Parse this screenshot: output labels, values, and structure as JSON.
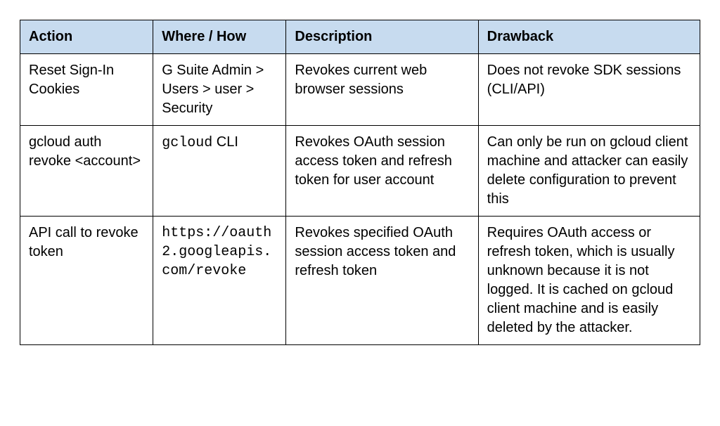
{
  "chart_data": {
    "type": "table",
    "headers": [
      "Action",
      "Where / How",
      "Description",
      "Drawback"
    ],
    "rows": [
      {
        "action": "Reset Sign-In Cookies",
        "where_plain": "G Suite Admin > Users > user > Security",
        "where_segments": null,
        "description": "Revokes current web browser sessions",
        "drawback": "Does not revoke SDK sessions (CLI/API)"
      },
      {
        "action": "gcloud auth revoke <account>",
        "where_plain": null,
        "where_segments": [
          {
            "text": "gcloud",
            "mono": true
          },
          {
            "text": " CLI",
            "mono": false
          }
        ],
        "description": "Revokes OAuth session access token and refresh token for user account",
        "drawback": "Can only be run on gcloud client machine and attacker can easily delete configuration to prevent this"
      },
      {
        "action": "API call to revoke token",
        "where_plain": "https://oauth2.googleapis.com/revoke",
        "where_mono": true,
        "where_wrap": true,
        "where_segments": null,
        "description": "Revokes specified OAuth session access token and refresh token",
        "drawback": "Requires OAuth access or refresh token, which is usually unknown because it is not logged. It is cached on gcloud client machine and is easily deleted by the attacker."
      }
    ]
  }
}
